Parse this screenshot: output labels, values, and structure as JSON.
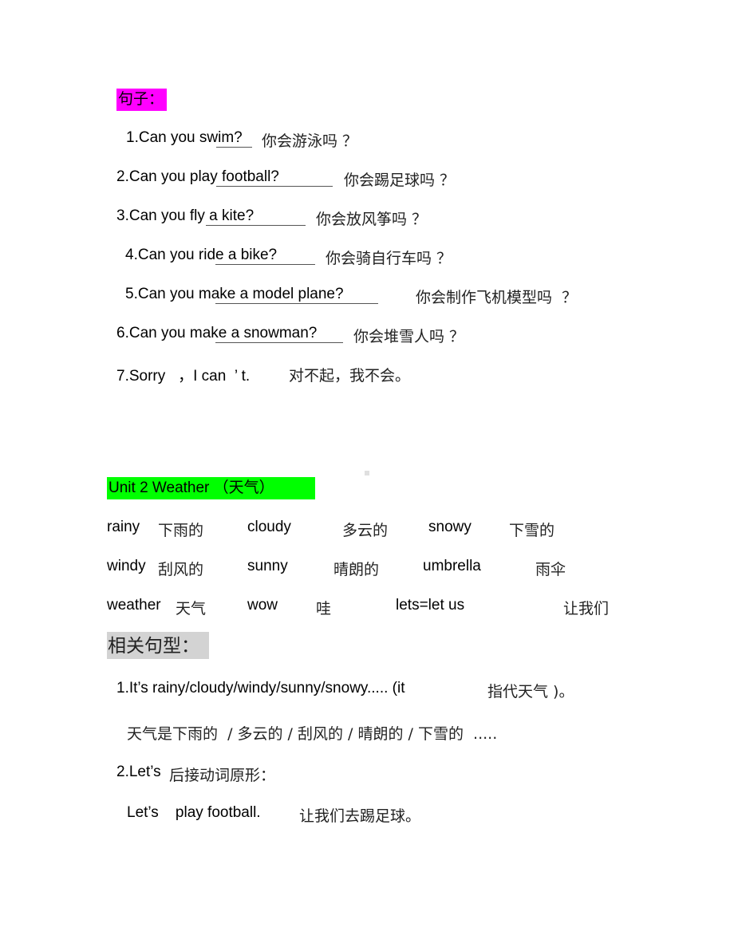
{
  "section_sentences": {
    "heading": "句子：",
    "items": [
      {
        "en": "1.Can you swim?",
        "zh": "你会游泳吗 ？"
      },
      {
        "en": "2.Can you play football?",
        "zh": "你会踢足球吗 ？"
      },
      {
        "en": "3.Can you fly a kite?",
        "zh": "你会放风筝吗 ？"
      },
      {
        "en": "4.Can you ride a bike?",
        "zh": "你会骑自行车吗 ？"
      },
      {
        "en": "5.Can you make a model plane?",
        "zh": "你会制作飞机模型吗  ？"
      },
      {
        "en": "6.Can you make a snowman?",
        "zh": "你会堆雪人吗 ？"
      },
      {
        "en": "7.Sorry   ，I can  ’ t.",
        "zh": "对不起，我不会。"
      }
    ]
  },
  "unit2": {
    "heading": "Unit 2 Weather       （天气）",
    "vocab_rows": [
      [
        {
          "en": "rainy",
          "zh": "下雨的"
        },
        {
          "en": "cloudy",
          "zh": "多云的"
        },
        {
          "en": "snowy",
          "zh": "下雪的"
        }
      ],
      [
        {
          "en": "windy",
          "zh": "刮风的"
        },
        {
          "en": "sunny",
          "zh": "晴朗的"
        },
        {
          "en": "umbrella",
          "zh": "雨伞"
        }
      ],
      [
        {
          "en": "weather",
          "zh": "天气"
        },
        {
          "en": "wow",
          "zh": "哇"
        },
        {
          "en": "lets=let us",
          "zh": "让我们"
        }
      ]
    ]
  },
  "patterns": {
    "heading": "相关句型：",
    "lines": [
      {
        "en": "1.It’s rainy/cloudy/windy/sunny/snowy..... (it",
        "zh": "指代天气 )。"
      },
      {
        "zh": "天气是下雨的  / 多云的 / 刮风的 / 晴朗的 / 下雪的  ....."
      },
      {
        "en": "2.Let’s",
        "zh": "后接动词原形："
      },
      {
        "en": "Let’s    play football.",
        "zh": "让我们去踢足球。"
      }
    ]
  }
}
